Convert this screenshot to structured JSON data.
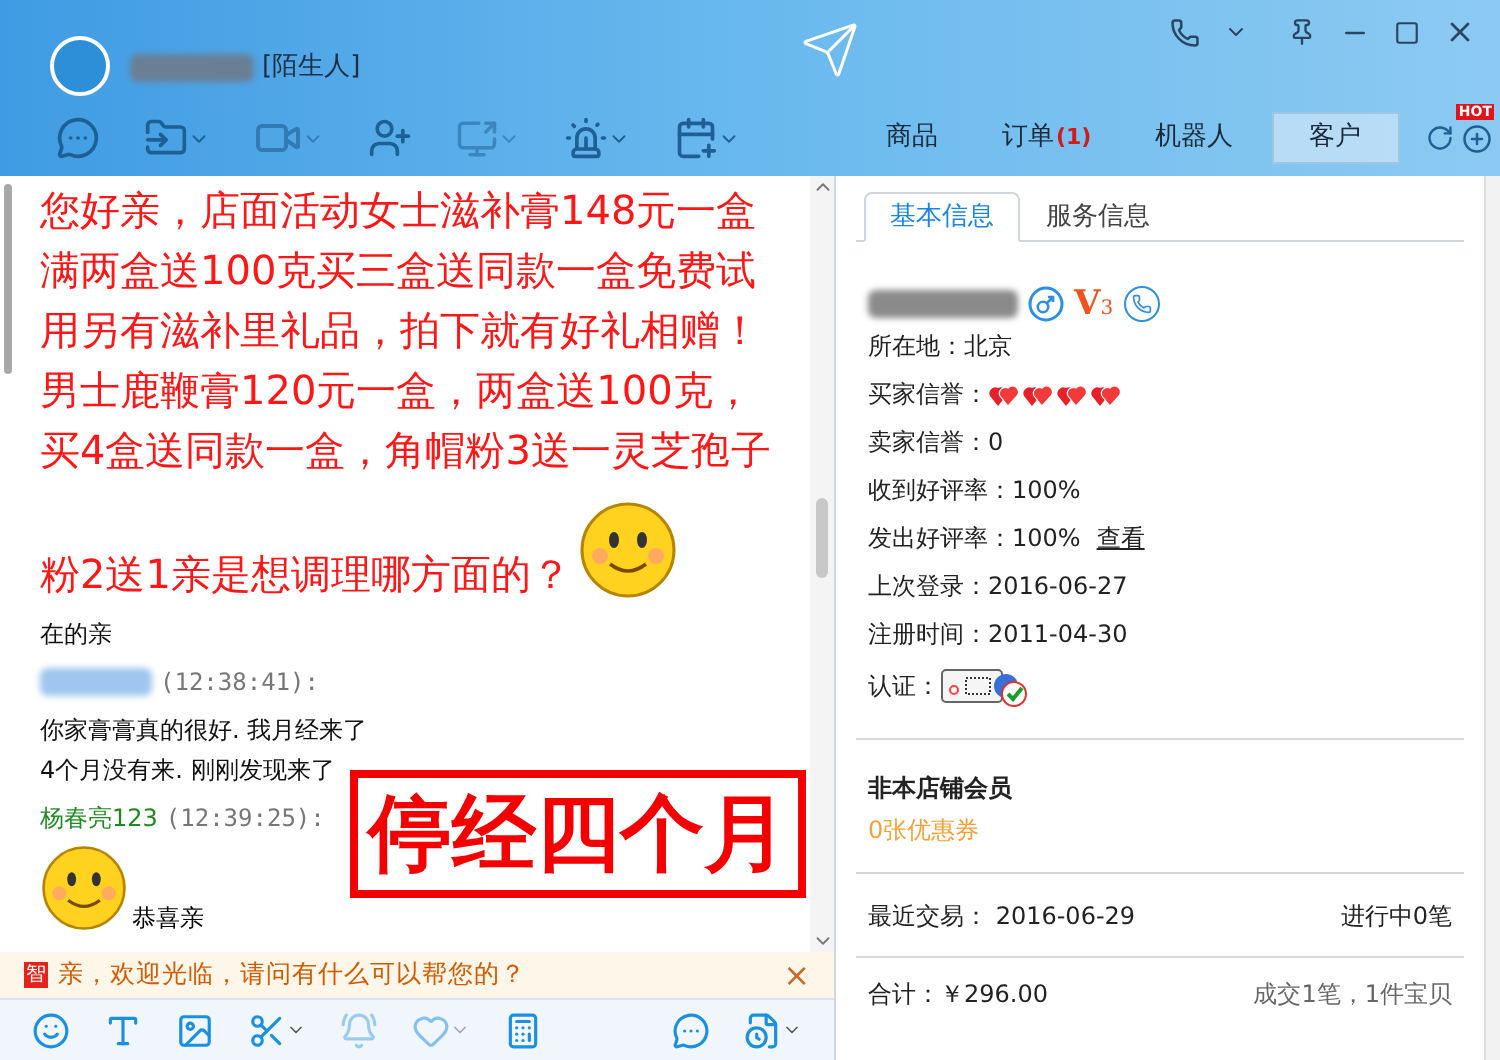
{
  "contact": {
    "tag": "[陌生人]"
  },
  "header_tabs": [
    {
      "label": "商品",
      "selected": false
    },
    {
      "label": "订单",
      "badge": "(1)",
      "selected": false
    },
    {
      "label": "机器人",
      "selected": false
    },
    {
      "label": "客户",
      "selected": true
    }
  ],
  "hot_badge": "HOT",
  "chat": {
    "promo_lines": [
      "您好亲，店面活动女士滋补膏148元一盒",
      "满两盒送100克买三盒送同款一盒免费试",
      "用另有滋补里礼品，拍下就有好礼相赠！",
      "男士鹿鞭膏120元一盒，两盒送100克，",
      "买4盒送同款一盒，角帽粉3送一灵芝孢子",
      "粉2送1亲是想调理哪方面的？"
    ],
    "messages": [
      {
        "kind": "text",
        "lines": [
          "在的亲"
        ]
      },
      {
        "kind": "header",
        "time": "(12:38:41):"
      },
      {
        "kind": "text",
        "lines": [
          "你家膏膏真的很好. 我月经来了",
          "4个月没有来. 刚刚发现来了"
        ]
      },
      {
        "kind": "header",
        "sender": "杨春亮123",
        "time": "(12:39:25):"
      },
      {
        "kind": "sticker",
        "caption": "恭喜亲"
      }
    ],
    "annotation": "停经四个月"
  },
  "notice": {
    "badge": "智",
    "text": "亲，欢迎光临，请问有什么可以帮您的？",
    "close": "×"
  },
  "side_tabs": [
    {
      "label": "基本信息",
      "selected": true
    },
    {
      "label": "服务信息",
      "selected": false
    }
  ],
  "profile": {
    "vip_letter": "V",
    "vip_number": "3",
    "fields": [
      {
        "kind": "text",
        "text": "所在地：北京"
      },
      {
        "kind": "hearts",
        "label": "买家信誉："
      },
      {
        "kind": "text",
        "text": "卖家信誉：0"
      },
      {
        "kind": "text",
        "text": "收到好评率：100%"
      },
      {
        "kind": "link",
        "text": "发出好评率：100%",
        "link": "查看"
      },
      {
        "kind": "text",
        "text": "上次登录：2016-06-27"
      },
      {
        "kind": "text",
        "text": "注册时间：2011-04-30"
      },
      {
        "kind": "cert",
        "label": "认证："
      }
    ]
  },
  "membership": {
    "status": "非本店铺会员",
    "coupons": "0张优惠券"
  },
  "recent": {
    "date": "最近交易： 2016-06-29",
    "pending": "进行中0笔"
  },
  "total": {
    "amount": "合计：￥296.00",
    "summary": "成交1笔，1件宝贝"
  }
}
